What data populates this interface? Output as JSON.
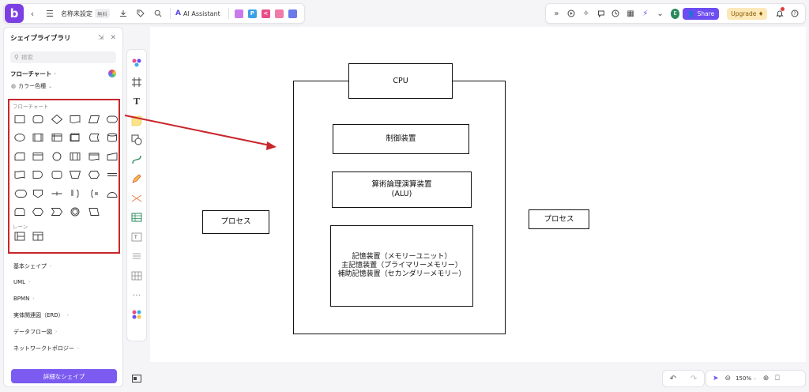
{
  "app": {
    "logo_letter": "b"
  },
  "toolbar": {
    "doc_title": "名称未設定",
    "plan_badge": "無料",
    "ai_label": "AI Assistant",
    "share_label": "Share",
    "upgrade_label": "Upgrade ♦",
    "avatar_letter": "E"
  },
  "library": {
    "title": "シェイプライブラリ",
    "search_placeholder": "検索",
    "category_flowchart": "フローチャート",
    "color_type": "カラー色種",
    "section_flowchart": "フローチャート",
    "section_lane": "レーン",
    "categories": [
      "基本シェイプ",
      "UML",
      "BPMN",
      "実体関連図（ERD）",
      "データフロー図",
      "ネットワークトポロジー"
    ],
    "detail_button": "詳細なシェイプ"
  },
  "diagram": {
    "cpu": "CPU",
    "control_unit": "制御装置",
    "alu": "算術論理演算装置\n(ALU)",
    "memory": "記憶装置（メモリーユニット）\n主記憶装置（プライマリーメモリー）\n補助記憶装置（セカンダリーメモリー）",
    "process_left": "プロセス",
    "process_right": "プロセス"
  },
  "zoom": {
    "level": "150%"
  },
  "colors": {
    "accent": "#6d4cf0",
    "highlight": "#c8262c",
    "logo": "#7b3fe4"
  }
}
